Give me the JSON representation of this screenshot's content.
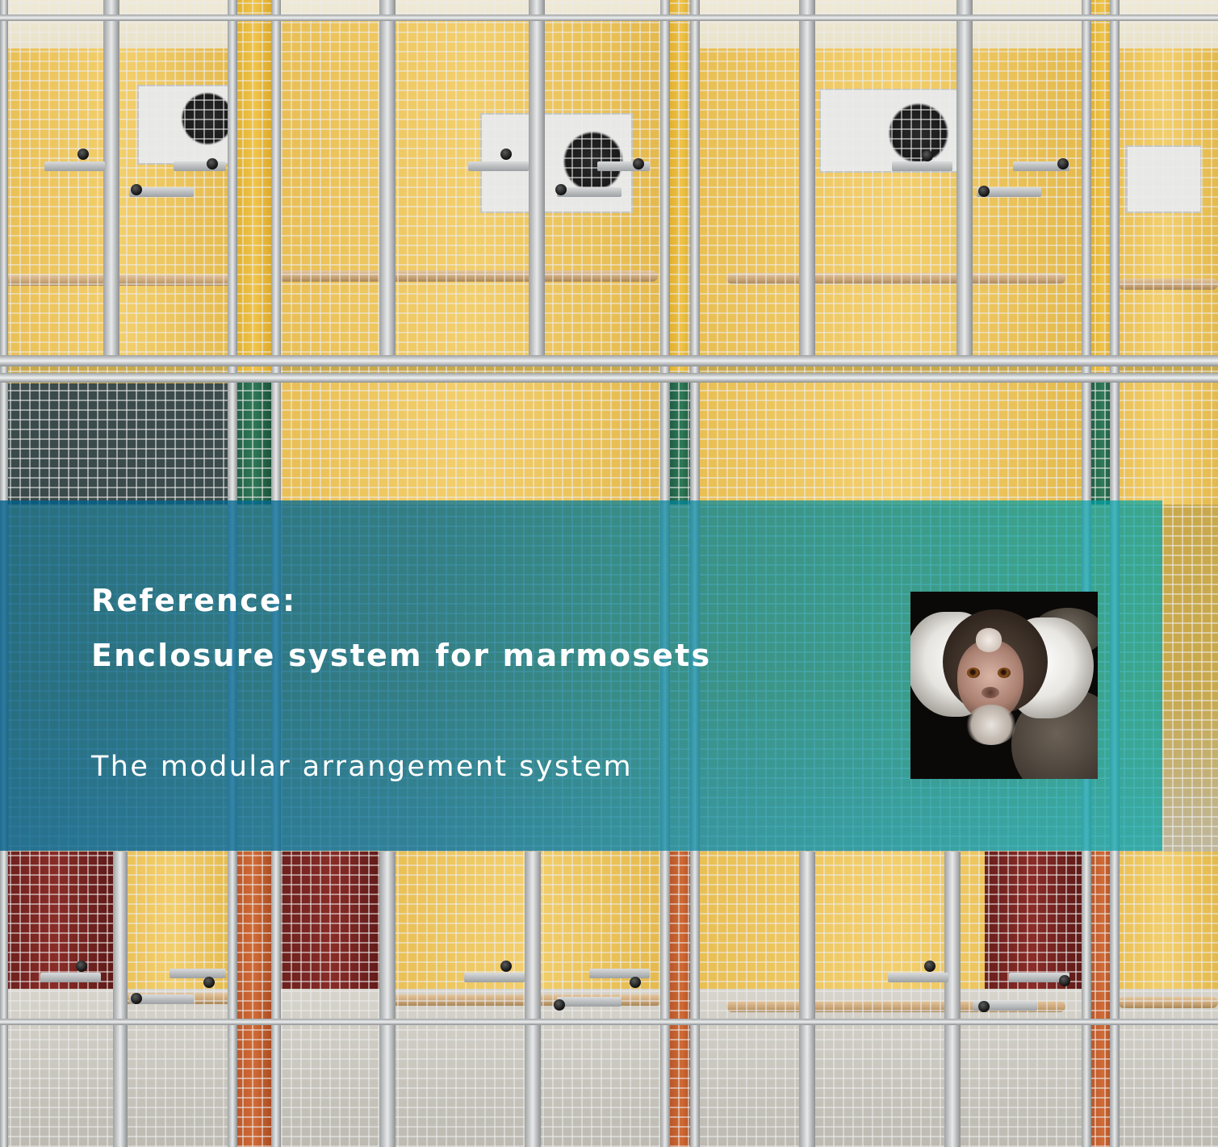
{
  "banner": {
    "title_line_1": "Reference:",
    "title_line_2": "Enclosure system for marmosets",
    "subtitle": "The modular arrangement system"
  },
  "colors": {
    "banner_left": "#005f8c",
    "banner_right": "#00a5aa",
    "text": "#ffffff",
    "wall_yellow": "#f0c44a",
    "panel_green": "#2f7a58",
    "panel_orange": "#d26b35",
    "panel_red": "#8a2c27"
  },
  "images": {
    "background": "laboratory-animal-enclosures-photo",
    "inset": "marmoset-photo"
  }
}
